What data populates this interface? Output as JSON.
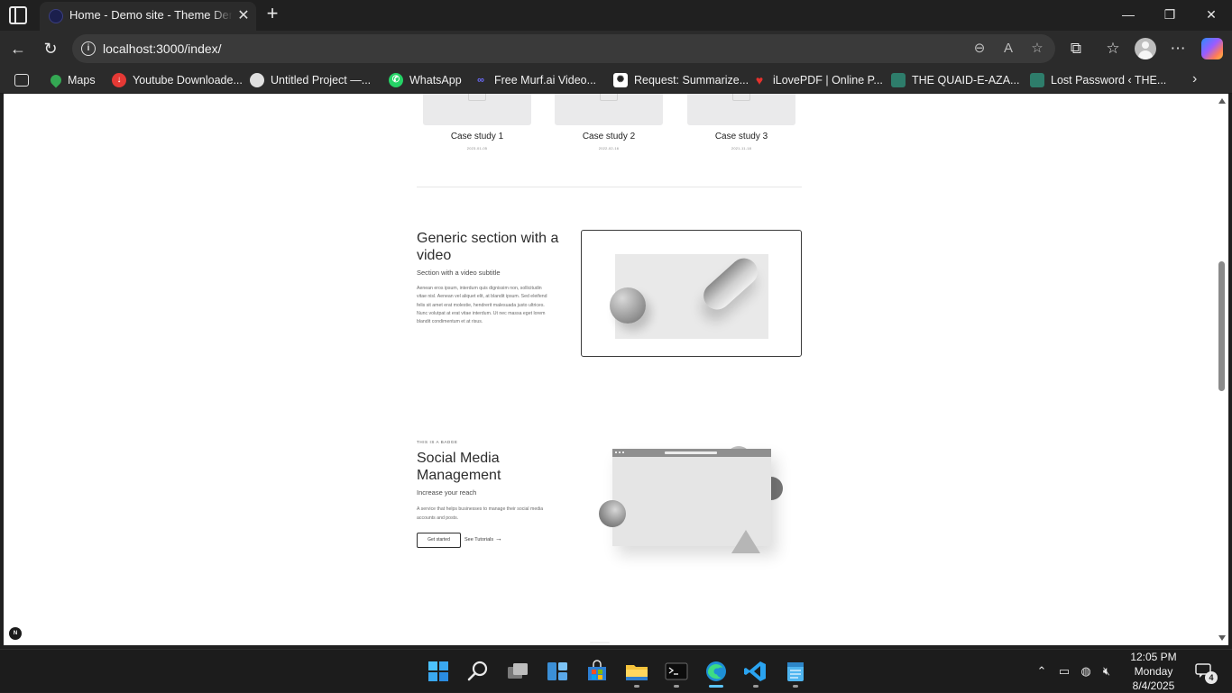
{
  "browser": {
    "tab_title": "Home - Demo site - Theme Demo",
    "tab_close": "✕",
    "new_tab": "+",
    "url": "localhost:3000/index/",
    "window_buttons": {
      "minimize": "—",
      "maximize": "❐",
      "close": "✕"
    }
  },
  "bookmarks": [
    {
      "label": "Maps",
      "icon": "maps-icon",
      "color": "#34a853"
    },
    {
      "label": "Youtube Downloade...",
      "icon": "youtube-downloader-icon",
      "color": "#e53935"
    },
    {
      "label": "Untitled Project —...",
      "icon": "untitled-project-icon",
      "color": "#e0e0e0"
    },
    {
      "label": "WhatsApp",
      "icon": "whatsapp-icon",
      "color": "#25d366"
    },
    {
      "label": "Free Murf.ai Video...",
      "icon": "murf-icon",
      "color": "#6d6dff"
    },
    {
      "label": "Request: Summarize...",
      "icon": "openai-icon",
      "color": "#ffffff"
    },
    {
      "label": "iLovePDF | Online P...",
      "icon": "ilovepdf-icon",
      "color": "#e5322d"
    },
    {
      "label": "THE QUAID-E-AZA...",
      "icon": "quaid-icon",
      "color": "#2e7d6b"
    },
    {
      "label": "Lost Password ‹ THE...",
      "icon": "lost-password-icon",
      "color": "#2e7d6b"
    }
  ],
  "page": {
    "case_studies": [
      {
        "title": "Case study 1",
        "date": "2023-01-05"
      },
      {
        "title": "Case study 2",
        "date": "2022-02-16"
      },
      {
        "title": "Case study 3",
        "date": "2021-11-18"
      }
    ],
    "video_section": {
      "title": "Generic section with a video",
      "subtitle": "Section with a video subtitle",
      "body": "Aenean eros ipsum, interdum quis dignissim non, sollicitudin vitae nisl. Aenean vel aliquet elit, at blandit ipsum. Sed eleifend felis sit amet erat molestie, hendrerit malesuada justo ultrices. Nunc volutpat at erat vitae interdum. Ut nec massa eget lorem blandit condimentum et at risus."
    },
    "smm_section": {
      "badge": "THIS IS A BADGE",
      "title": "Social Media Management",
      "subtitle": "Increase your reach",
      "body": "A service that helps businesses to manage their social media accounts and posts.",
      "primary_button": "Get started",
      "link_button": "See Tutorials",
      "link_arrow": "→"
    },
    "framework_badge": "N"
  },
  "taskbar": {
    "time": "12:05 PM",
    "day": "Monday",
    "date": "8/4/2025",
    "notification_count": "4"
  }
}
